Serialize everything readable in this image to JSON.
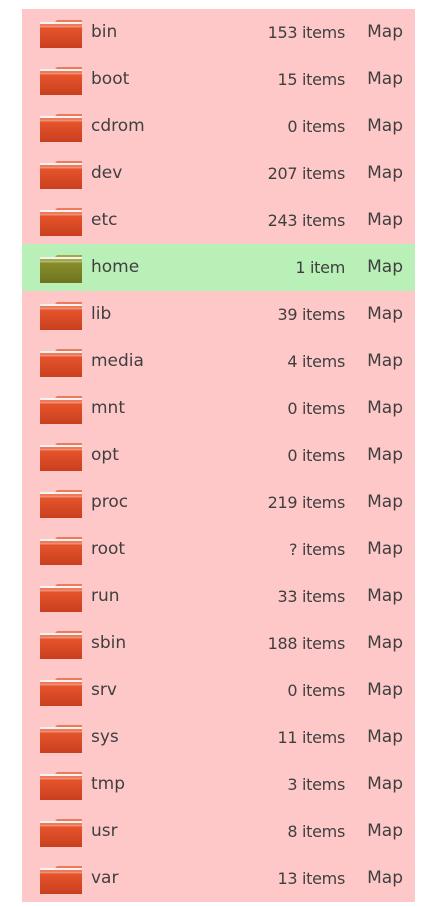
{
  "colors": {
    "row_background": "#ffc8c8",
    "selected_row_background": "#b9f0b7",
    "folder_orange": "#e8552c",
    "folder_selected": "#8a8f2a",
    "text": "#3f3f3f"
  },
  "file_list": {
    "icon": "folder-icon",
    "selected_index": 5,
    "rows": [
      {
        "name": "bin",
        "size": "153 items",
        "type": "Map"
      },
      {
        "name": "boot",
        "size": "15 items",
        "type": "Map"
      },
      {
        "name": "cdrom",
        "size": "0 items",
        "type": "Map"
      },
      {
        "name": "dev",
        "size": "207 items",
        "type": "Map"
      },
      {
        "name": "etc",
        "size": "243 items",
        "type": "Map"
      },
      {
        "name": "home",
        "size": "1 item",
        "type": "Map"
      },
      {
        "name": "lib",
        "size": "39 items",
        "type": "Map"
      },
      {
        "name": "media",
        "size": "4 items",
        "type": "Map"
      },
      {
        "name": "mnt",
        "size": "0 items",
        "type": "Map"
      },
      {
        "name": "opt",
        "size": "0 items",
        "type": "Map"
      },
      {
        "name": "proc",
        "size": "219 items",
        "type": "Map"
      },
      {
        "name": "root",
        "size": "? items",
        "type": "Map"
      },
      {
        "name": "run",
        "size": "33 items",
        "type": "Map"
      },
      {
        "name": "sbin",
        "size": "188 items",
        "type": "Map"
      },
      {
        "name": "srv",
        "size": "0 items",
        "type": "Map"
      },
      {
        "name": "sys",
        "size": "11 items",
        "type": "Map"
      },
      {
        "name": "tmp",
        "size": "3 items",
        "type": "Map"
      },
      {
        "name": "usr",
        "size": "8 items",
        "type": "Map"
      },
      {
        "name": "var",
        "size": "13 items",
        "type": "Map"
      }
    ]
  }
}
